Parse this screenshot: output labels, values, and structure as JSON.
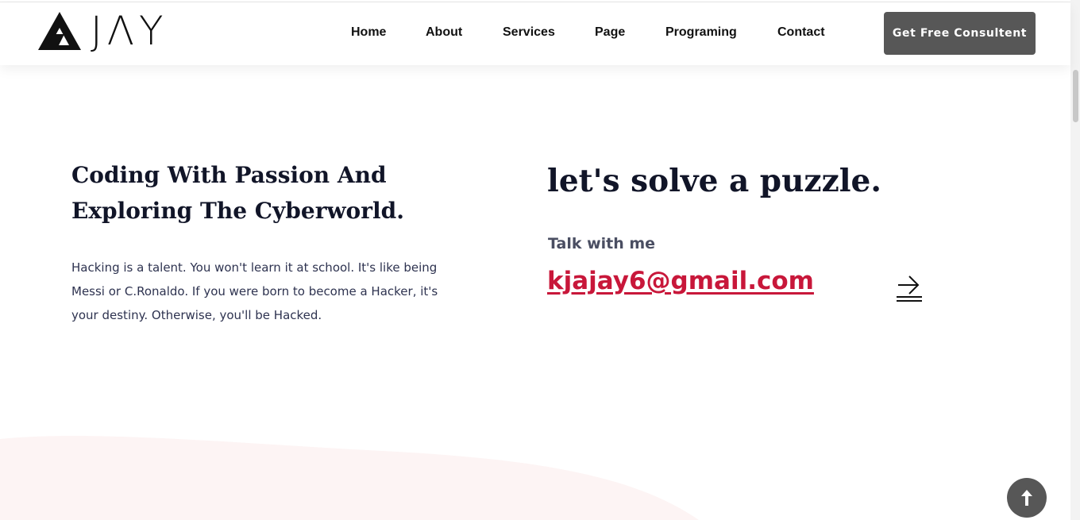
{
  "header": {
    "logo_text": "AJAY",
    "nav": [
      {
        "label": "Home"
      },
      {
        "label": "About"
      },
      {
        "label": "Services"
      },
      {
        "label": "Page"
      },
      {
        "label": "Programing"
      },
      {
        "label": "Contact"
      }
    ],
    "cta_label": "Get Free Consultent"
  },
  "intro": {
    "headline": "Coding With Passion And Exploring The Cyberworld.",
    "body": "Hacking is a talent. You won't learn it at school. It's like being Messi or C.Ronaldo. If you were born to become a Hacker, it's your destiny. Otherwise, you'll be Hacked."
  },
  "contact": {
    "headline": "let's solve a puzzle.",
    "talk_label": "Talk with me",
    "email": "kjajay6@gmail.com"
  },
  "colors": {
    "accent": "#c8173a",
    "dark_button": "#575757",
    "heading": "#111528"
  },
  "icons": {
    "arrow": "arrow-right-icon",
    "to_top": "arrow-up-icon"
  }
}
